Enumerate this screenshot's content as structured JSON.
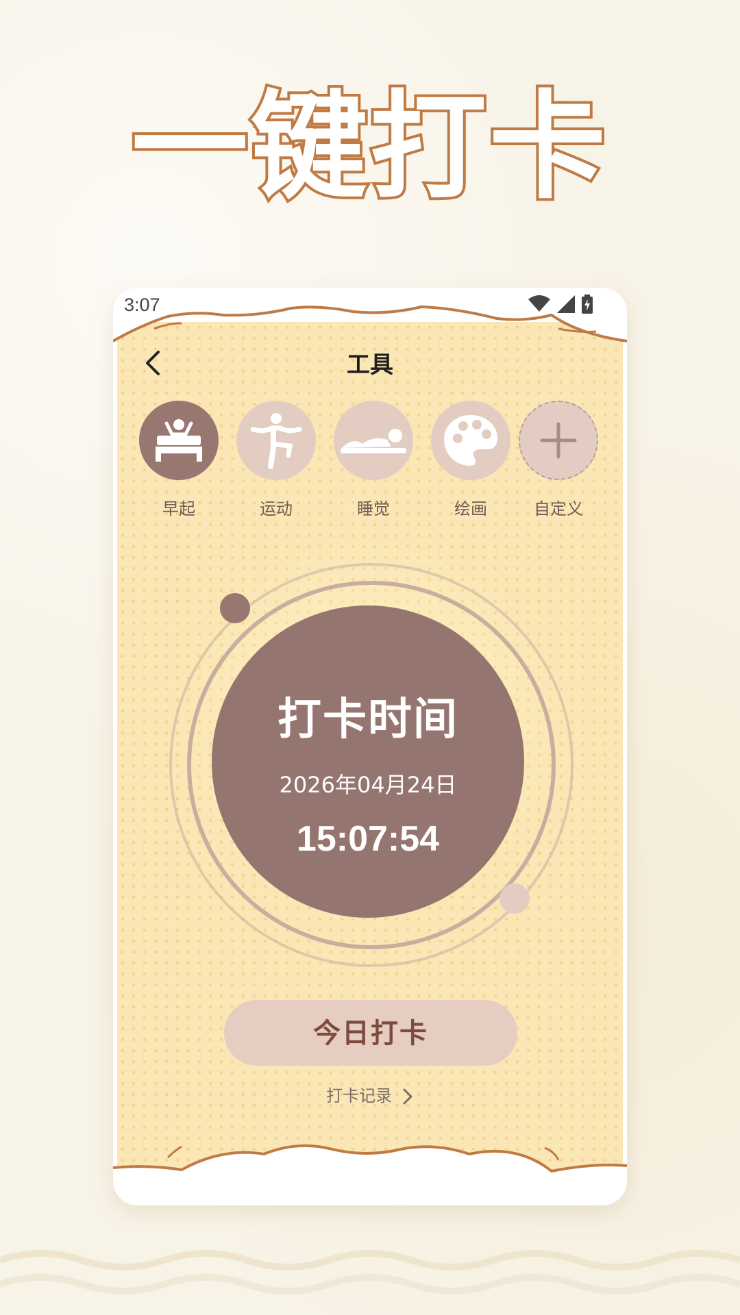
{
  "hero": {
    "title": "一键打卡"
  },
  "status_bar": {
    "time": "3:07"
  },
  "nav": {
    "title": "工具"
  },
  "categories": [
    {
      "label": "早起",
      "icon": "bed-wakeup-icon",
      "active": true
    },
    {
      "label": "运动",
      "icon": "exercise-icon",
      "active": false
    },
    {
      "label": "睡觉",
      "icon": "sleep-icon",
      "active": false
    },
    {
      "label": "绘画",
      "icon": "palette-icon",
      "active": false
    },
    {
      "label": "自定义",
      "icon": "plus-icon",
      "active": false
    }
  ],
  "clock": {
    "title": "打卡时间",
    "date": "2026年04月24日",
    "time": "15:07:54"
  },
  "actions": {
    "checkin_label": "今日打卡",
    "records_label": "打卡记录"
  },
  "colors": {
    "accent": "#957570",
    "soft": "#e3cdc2",
    "background": "#fbe6b5",
    "outline": "#c07a43"
  }
}
